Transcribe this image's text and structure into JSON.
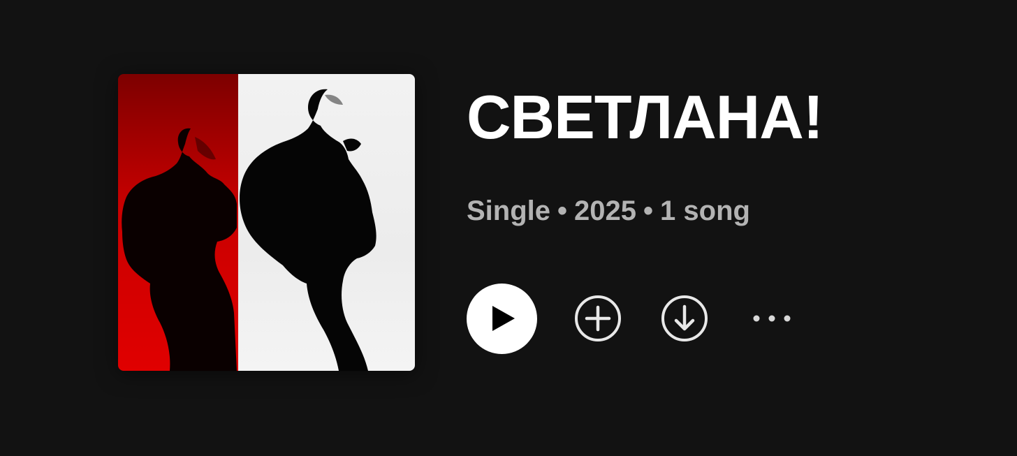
{
  "album": {
    "title": "СВЕТЛАНА!",
    "meta": {
      "type": "Single",
      "year": "2025",
      "song_count": "1 song",
      "separator": "•"
    }
  },
  "colors": {
    "background": "#121212",
    "title": "#ffffff",
    "meta_text": "#b3b3b3",
    "play_button": "#ffffff",
    "cover_left": "#d40000",
    "cover_right": "#efefef"
  },
  "controls": {
    "play_icon": "play-icon",
    "add_icon": "plus-circle-icon",
    "download_icon": "download-circle-icon",
    "more_icon": "more-horizontal-icon"
  }
}
